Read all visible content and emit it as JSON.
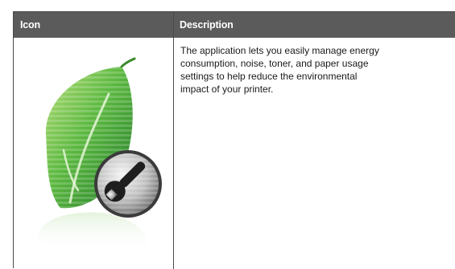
{
  "table": {
    "headers": {
      "icon": "Icon",
      "description": "Description"
    },
    "row": {
      "icon": "eco-settings-leaf-wrench-icon",
      "description_lines": [
        "The application lets you easily manage energy",
        "consumption, noise, toner, and paper usage",
        "settings to help reduce the environmental",
        "impact of your printer."
      ]
    }
  },
  "colors": {
    "header_background": "#5b5b5b",
    "header_text": "#ffffff",
    "leaf_green": "#4aa63c",
    "border": "#4a4a4a"
  }
}
